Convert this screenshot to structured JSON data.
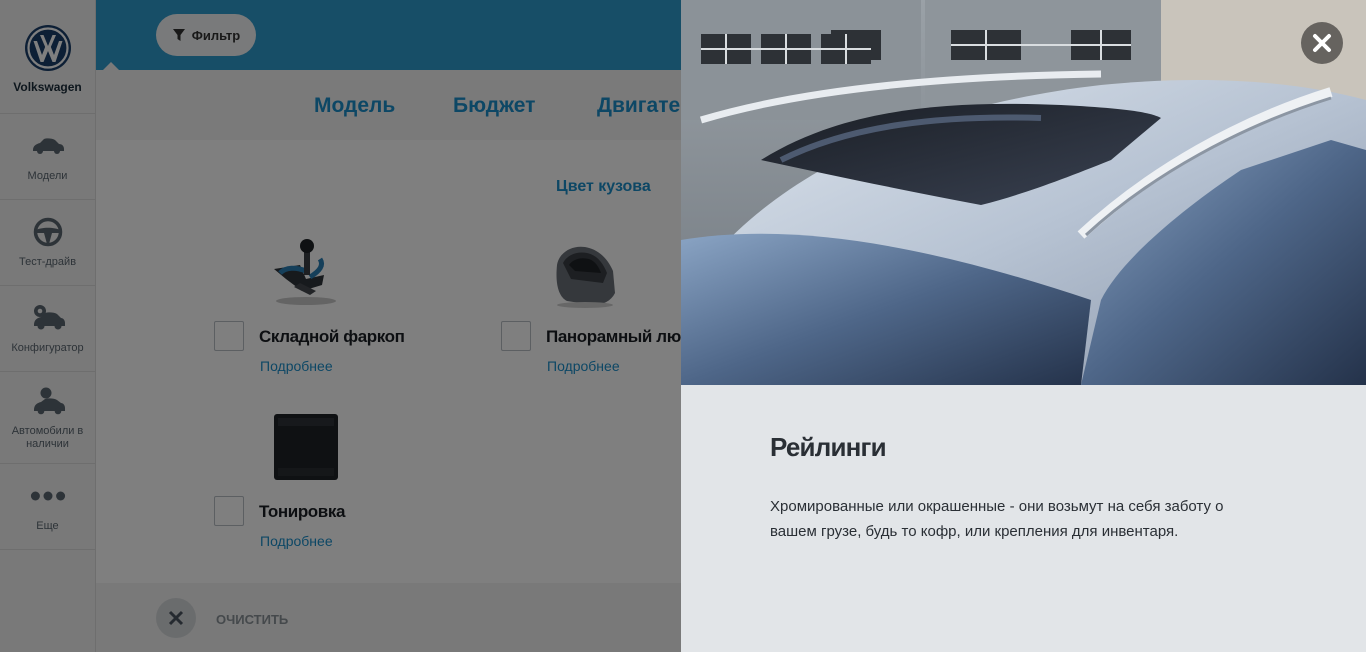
{
  "brand": {
    "name": "Volkswagen",
    "logo_icon": "vw-logo-icon"
  },
  "sidebar": {
    "items": [
      {
        "label": "Модели",
        "icon": "car-icon"
      },
      {
        "label": "Тест-драйв",
        "icon": "steering-wheel-icon"
      },
      {
        "label": "Конфигуратор",
        "icon": "configurator-icon"
      },
      {
        "label": "Автомобили в наличии",
        "icon": "car-person-icon"
      },
      {
        "label": "Еще",
        "icon": "more-dots-icon"
      }
    ]
  },
  "topbar": {
    "filter_label": "Фильтр",
    "filter_icon": "funnel-icon",
    "color": "#2e9cce"
  },
  "tabs": [
    {
      "label": "Модель"
    },
    {
      "label": "Бюджет"
    },
    {
      "label": "Двигате"
    }
  ],
  "content": {
    "section_title": "Цвет кузова",
    "options": [
      {
        "name": "Складной фаркоп",
        "more": "Подробнее",
        "icon": "towbar-icon"
      },
      {
        "name": "Панорамный люк",
        "more": "Подробнее",
        "icon": "panoramic-roof-icon"
      },
      {
        "name": "Тонировка",
        "more": "Подробнее",
        "icon": "tinting-icon"
      }
    ]
  },
  "footer": {
    "clear_label": "ОЧИСТИТЬ",
    "clear_icon": "close-icon"
  },
  "modal": {
    "title": "Рейлинги",
    "description": "Хромированные или окрашенные - они возьмут на себя заботу о вашем грузе, будь то кофр, или крепления для инвентаря.",
    "close_icon": "close-icon",
    "image": "roof-rails-photo"
  },
  "colors": {
    "accent": "#1a8fcb",
    "topbar": "#2e9cce",
    "panel_bg": "#e2e5e8"
  }
}
